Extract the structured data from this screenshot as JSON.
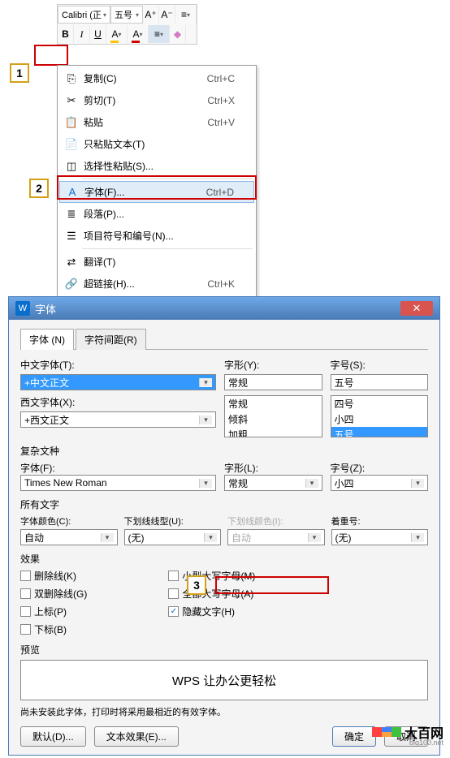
{
  "toolbar": {
    "font": "Calibri (正",
    "size": "五号",
    "incFont": "A⁺",
    "decFont": "A⁻"
  },
  "markers": {
    "m1": "1",
    "m2": "2",
    "m3": "3"
  },
  "ctx": {
    "copy": {
      "label": "复制(C)",
      "shortcut": "Ctrl+C"
    },
    "cut": {
      "label": "剪切(T)",
      "shortcut": "Ctrl+X"
    },
    "paste": {
      "label": "粘贴",
      "shortcut": "Ctrl+V"
    },
    "pasteText": {
      "label": "只粘贴文本(T)"
    },
    "pasteSpecial": {
      "label": "选择性粘贴(S)..."
    },
    "font": {
      "label": "字体(F)...",
      "shortcut": "Ctrl+D"
    },
    "paragraph": {
      "label": "段落(P)..."
    },
    "bullets": {
      "label": "项目符号和编号(N)..."
    },
    "translate": {
      "label": "翻译(T)"
    },
    "hyperlink": {
      "label": "超链接(H)...",
      "shortcut": "Ctrl+K"
    }
  },
  "dialog": {
    "title": "字体",
    "tabs": {
      "font": "字体 (N)",
      "spacing": "字符间距(R)"
    },
    "labels": {
      "cnFont": "中文字体(T):",
      "enFont": "西文字体(X):",
      "style": "字形(Y):",
      "size": "字号(S):",
      "complex": "复杂文种",
      "cFont": "字体(F):",
      "cStyle": "字形(L):",
      "cSize": "字号(Z):",
      "allText": "所有文字",
      "fontColor": "字体颜色(C):",
      "underlineStyle": "下划线线型(U):",
      "underlineColor": "下划线颜色(I):",
      "emphasis": "着重号:",
      "effects": "效果",
      "preview": "预览",
      "hint": "尚未安装此字体，打印时将采用最相近的有效字体。"
    },
    "values": {
      "cnFont": "+中文正文",
      "enFont": "+西文正文",
      "style": "常规",
      "size": "五号",
      "styleOpts": [
        "常规",
        "倾斜",
        "加粗"
      ],
      "sizeOpts": [
        "四号",
        "小四",
        "五号"
      ],
      "cFont": "Times New Roman",
      "cStyle": "常规",
      "cSize": "小四",
      "auto": "自动",
      "none": "(无)",
      "previewText": "WPS 让办公更轻松"
    },
    "fx": {
      "strike": "删除线(K)",
      "dblStrike": "双删除线(G)",
      "superscript": "上标(P)",
      "subscript": "下标(B)",
      "smallCaps": "小型大写字母(M)",
      "allCaps": "全部大写字母(A)",
      "hidden": "隐藏文字(H)"
    },
    "buttons": {
      "default": "默认(D)...",
      "textEffect": "文本效果(E)...",
      "ok": "确定",
      "cancel": "取消"
    }
  },
  "watermark": {
    "text": "大百网",
    "sub": "big100.net"
  }
}
